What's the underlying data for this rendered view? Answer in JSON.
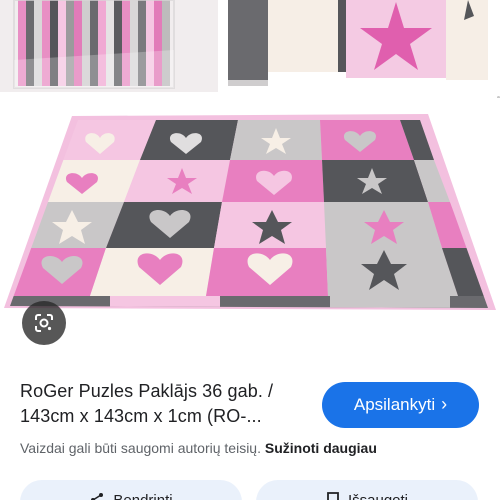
{
  "product": {
    "title_line1": "RoGer Puzles Paklājs 36 gab. /",
    "title_line2": "143cm x 143cm x 1cm (RO-..."
  },
  "visit_button": {
    "label": "Apsilankyti",
    "icon": "chevron-right-icon"
  },
  "copyright": {
    "notice": "Vaizdai gali būti saugomi autorių teisių.",
    "learn_more": "Sužinoti daugiau"
  },
  "bottom_actions": {
    "share_label": "Bendrinti",
    "share_icon": "share-icon",
    "save_label": "Išsaugoti",
    "save_icon": "bookmark-icon"
  },
  "lens_button": {
    "icon": "google-lens-icon"
  },
  "colors": {
    "accent": "#1a73e8",
    "pink": "#e87fc0",
    "light_pink": "#f5c6e2",
    "gray": "#c9c7c8",
    "dark_gray": "#55565a",
    "cream": "#f7efe6"
  }
}
